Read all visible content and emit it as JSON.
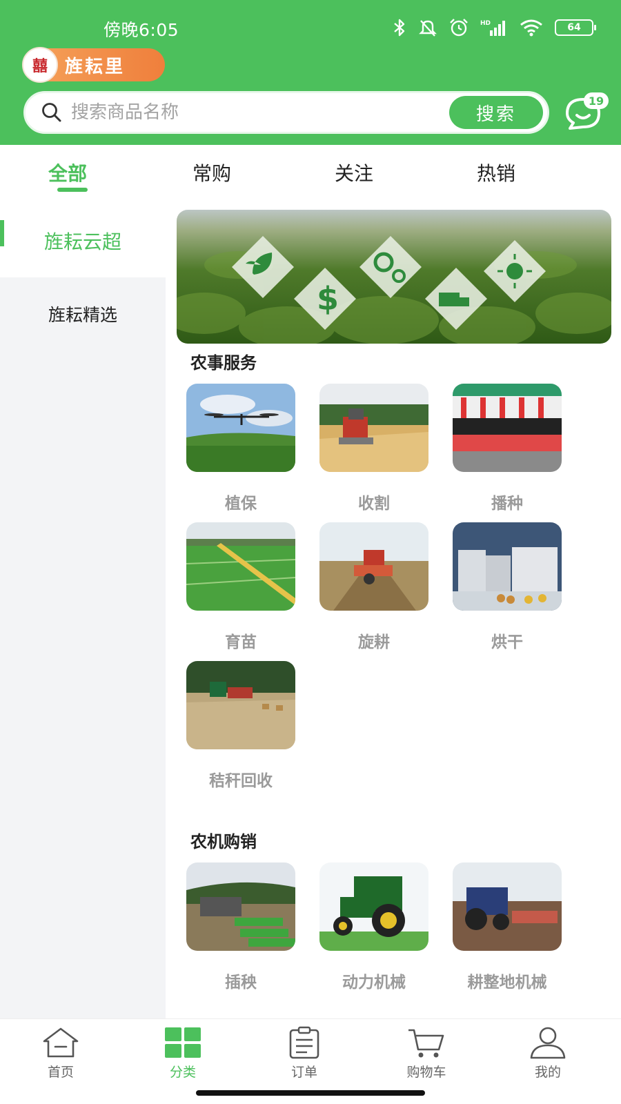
{
  "status_bar": {
    "time": "傍晚6:05",
    "battery": "64",
    "network": "HD"
  },
  "header": {
    "logo_mark": "囍",
    "logo_text": "旌耘里",
    "search_placeholder": "搜索商品名称",
    "search_button": "搜索",
    "message_badge": "19"
  },
  "tabs": [
    {
      "label": "全部",
      "active": true
    },
    {
      "label": "常购",
      "active": false
    },
    {
      "label": "关注",
      "active": false
    },
    {
      "label": "热销",
      "active": false
    }
  ],
  "sidebar": [
    {
      "label": "旌耘云超",
      "active": true
    },
    {
      "label": "旌耘精选",
      "active": false
    }
  ],
  "sections": [
    {
      "title": "农事服务",
      "items": [
        {
          "label": "植保",
          "icon": "drone-over-field"
        },
        {
          "label": "收割",
          "icon": "harvester-in-wheat"
        },
        {
          "label": "播种",
          "icon": "seeder-machine"
        },
        {
          "label": "育苗",
          "icon": "seedling-nursery"
        },
        {
          "label": "旋耕",
          "icon": "rotary-tiller"
        },
        {
          "label": "烘干",
          "icon": "drying-machine"
        },
        {
          "label": "秸秆回收",
          "icon": "straw-baling"
        }
      ]
    },
    {
      "title": "农机购销",
      "items": [
        {
          "label": "插秧",
          "icon": "rice-transplanter"
        },
        {
          "label": "动力机械",
          "icon": "green-tractor"
        },
        {
          "label": "耕整地机械",
          "icon": "tillage-tractor"
        }
      ]
    }
  ],
  "bottom_nav": [
    {
      "label": "首页",
      "icon": "home-icon",
      "active": false
    },
    {
      "label": "分类",
      "icon": "grid-icon",
      "active": true
    },
    {
      "label": "订单",
      "icon": "clipboard-icon",
      "active": false
    },
    {
      "label": "购物车",
      "icon": "cart-icon",
      "active": false
    },
    {
      "label": "我的",
      "icon": "user-icon",
      "active": false
    }
  ],
  "colors": {
    "brand_green": "#4cc05c",
    "logo_orange": "#ef7f3c",
    "sidebar_bg": "#f3f4f6"
  }
}
